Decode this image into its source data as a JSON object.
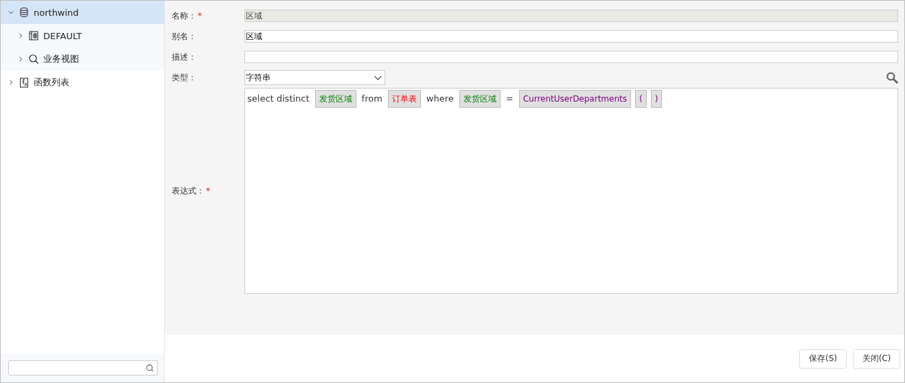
{
  "tree": [
    {
      "label": "northwind",
      "kind": "database",
      "expanded": true,
      "selected": true,
      "children": [
        {
          "label": "DEFAULT",
          "kind": "table",
          "expanded": false,
          "selected": false
        },
        {
          "label": "业务视图",
          "kind": "view",
          "expanded": false,
          "selected": false
        }
      ]
    },
    {
      "label": "函数列表",
      "kind": "function",
      "expanded": false,
      "selected": false
    }
  ],
  "form": [
    {
      "label": "名称：",
      "mark": "*",
      "kind": "text",
      "value": "区域",
      "disabled": true
    },
    {
      "label": "别名：",
      "kind": "text",
      "value": "区域"
    },
    {
      "label": "描述：",
      "kind": "text"
    },
    {
      "label": "类型：",
      "kind": "select",
      "value": "字符串"
    }
  ],
  "expression": {
    "label": "表达式：",
    "mark": "*",
    "tokens": [
      {
        "kind": "text",
        "text": "select distinct"
      },
      {
        "kind": "field",
        "text": "发货区域"
      },
      {
        "kind": "text",
        "text": "from"
      },
      {
        "kind": "table",
        "text": "订单表"
      },
      {
        "kind": "text",
        "text": "where"
      },
      {
        "kind": "field",
        "text": "发货区域"
      },
      {
        "kind": "text",
        "text": "="
      },
      {
        "kind": "function",
        "text": "CurrentUserDepartments"
      },
      {
        "kind": "function",
        "text": "("
      },
      {
        "kind": "function",
        "text": ")"
      }
    ]
  },
  "buttons": [
    "保存(S)",
    "关闭(C)"
  ]
}
